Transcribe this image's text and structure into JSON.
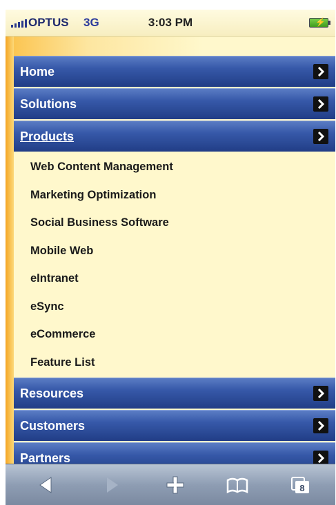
{
  "status_bar": {
    "carrier": "OPTUS",
    "network": "3G",
    "time": "3:03 PM"
  },
  "menu": {
    "items": [
      {
        "label": "Home"
      },
      {
        "label": "Solutions"
      },
      {
        "label": "Products",
        "active": true
      }
    ],
    "products_submenu": [
      "Web Content Management",
      "Marketing Optimization",
      "Social Business Software",
      "Mobile Web",
      "eIntranet",
      "eSync",
      "eCommerce",
      "Feature List"
    ],
    "items_after": [
      {
        "label": "Resources"
      },
      {
        "label": "Customers"
      },
      {
        "label": "Partners"
      }
    ]
  },
  "toolbar": {
    "tabs_count": "8",
    "buttons": [
      "back-icon",
      "forward-icon",
      "plus-icon",
      "bookmarks-icon",
      "tabs-icon"
    ]
  }
}
